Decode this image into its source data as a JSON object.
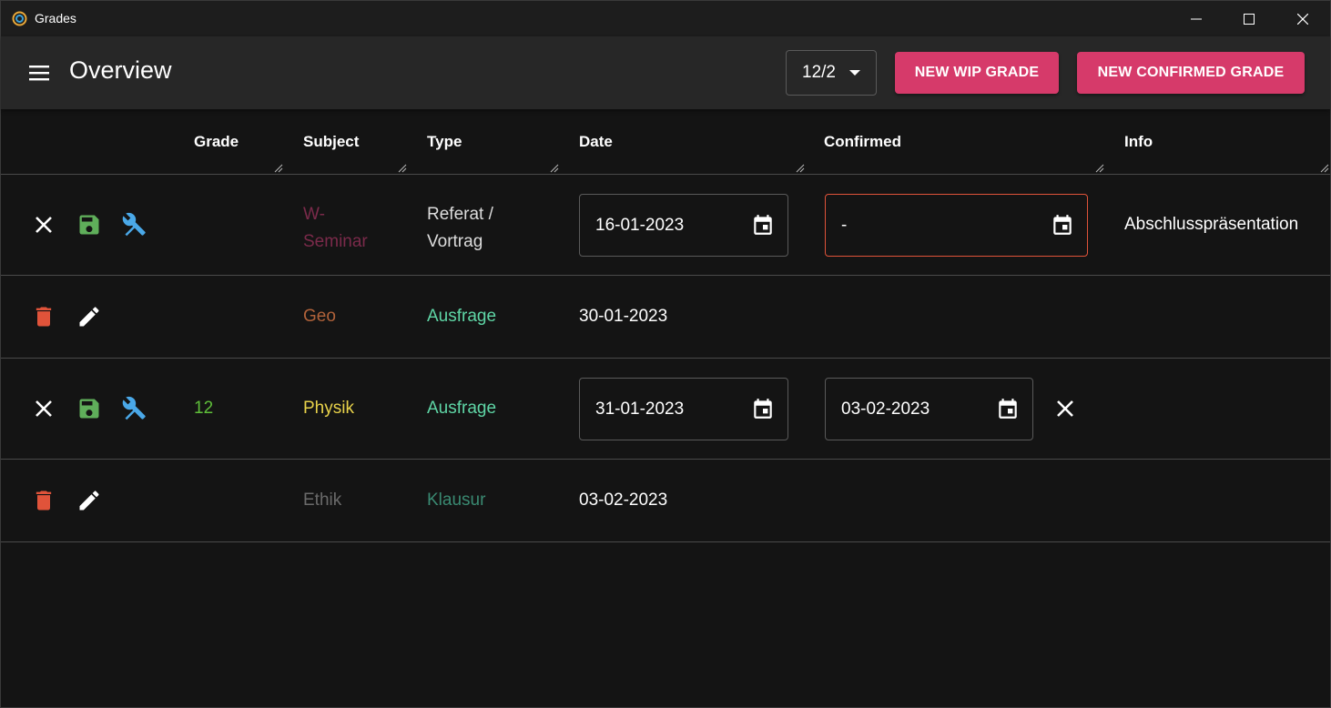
{
  "window": {
    "title": "Grades"
  },
  "appbar": {
    "title": "Overview",
    "year_select": "12/2",
    "new_wip_label": "NEW WIP GRADE",
    "new_confirmed_label": "NEW CONFIRMED GRADE",
    "accent": "#d63a6a"
  },
  "table": {
    "columns": [
      "Grade",
      "Subject",
      "Type",
      "Date",
      "Confirmed",
      "Info"
    ],
    "rows": [
      {
        "mode": "edit",
        "grade": "",
        "subject_line1": "W-",
        "subject_line2": "Seminar",
        "subject_color": "#7a2a4a",
        "type_line1": "Referat /",
        "type_line2": "Vortrag",
        "type_color": "#dddddd",
        "date": "16-01-2023",
        "confirmed": "-",
        "info": "Abschlusspräsentation"
      },
      {
        "mode": "view",
        "grade": "",
        "subject": "Geo",
        "subject_color": "#b0623a",
        "type": "Ausfrage",
        "type_color": "#5fd6a6",
        "date": "30-01-2023"
      },
      {
        "mode": "edit",
        "grade": "12",
        "grade_color": "#5fbf3a",
        "subject": "Physik",
        "subject_color": "#e8d24a",
        "type": "Ausfrage",
        "type_color": "#5fd6a6",
        "date": "31-01-2023",
        "confirmed": "03-02-2023"
      },
      {
        "mode": "view",
        "grade": "",
        "subject": "Ethik",
        "subject_color": "#6a6a6a",
        "type": "Klausur",
        "type_color": "#3a8a72",
        "date": "03-02-2023"
      }
    ]
  },
  "icons": {
    "cancel": "close-icon",
    "save": "save-icon",
    "tools": "tools-icon",
    "delete": "trash-icon",
    "edit": "pencil-icon",
    "calendar": "calendar-icon"
  },
  "colors": {
    "save": "#5fae5a",
    "tools": "#4aa8e8",
    "delete": "#e0533a"
  }
}
